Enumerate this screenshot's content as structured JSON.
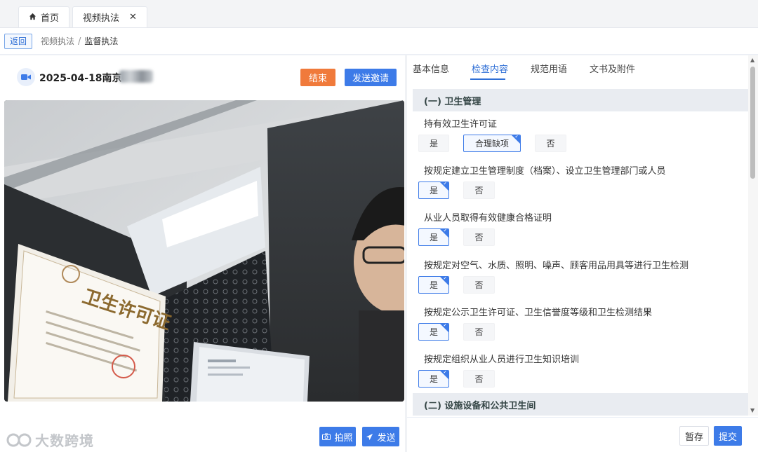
{
  "tabs": [
    {
      "label": "首页",
      "icon": "home-icon"
    },
    {
      "label": "视频执法",
      "close": "✕"
    }
  ],
  "breadcrumb": {
    "back_label": "返回",
    "items": [
      "视频执法",
      "监督执法"
    ],
    "separator": "/"
  },
  "session": {
    "title": "2025-04-18南京",
    "icon": "video-camera-icon",
    "end_label": "结束",
    "invite_label": "发送邀请"
  },
  "video_overlay": {
    "certificate_heading": "卫生许可证"
  },
  "video_footer": {
    "watermark": "大数跨境",
    "photo_label": "拍照",
    "send_label": "发送"
  },
  "right_tabs": [
    {
      "label": "基本信息",
      "active": false
    },
    {
      "label": "检查内容",
      "active": true
    },
    {
      "label": "规范用语",
      "active": false
    },
    {
      "label": "文书及附件",
      "active": false
    }
  ],
  "sections": [
    {
      "title": "(一) 卫生管理"
    },
    {
      "title": "(二) 设施设备和公共卫生间"
    }
  ],
  "questions": [
    {
      "text": "持有效卫生许可证",
      "options": [
        "是",
        "合理缺项",
        "否"
      ],
      "selected": "合理缺项"
    },
    {
      "text": "按规定建立卫生管理制度（档案）、设立卫生管理部门或人员",
      "options": [
        "是",
        "否"
      ],
      "selected": "是"
    },
    {
      "text": "从业人员取得有效健康合格证明",
      "options": [
        "是",
        "否"
      ],
      "selected": "是"
    },
    {
      "text": "按规定对空气、水质、照明、噪声、顾客用品用具等进行卫生检测",
      "options": [
        "是",
        "否"
      ],
      "selected": "是"
    },
    {
      "text": "按规定公示卫生许可证、卫生信誉度等级和卫生检测结果",
      "options": [
        "是",
        "否"
      ],
      "selected": "是"
    },
    {
      "text": "按规定组织从业人员进行卫生知识培训",
      "options": [
        "是",
        "否"
      ],
      "selected": "是"
    }
  ],
  "footer": {
    "save_label": "暂存",
    "submit_label": "提交"
  },
  "colors": {
    "primary": "#3d7be8",
    "end_button": "#f07a3b",
    "section_bg": "#e9ecf1"
  }
}
